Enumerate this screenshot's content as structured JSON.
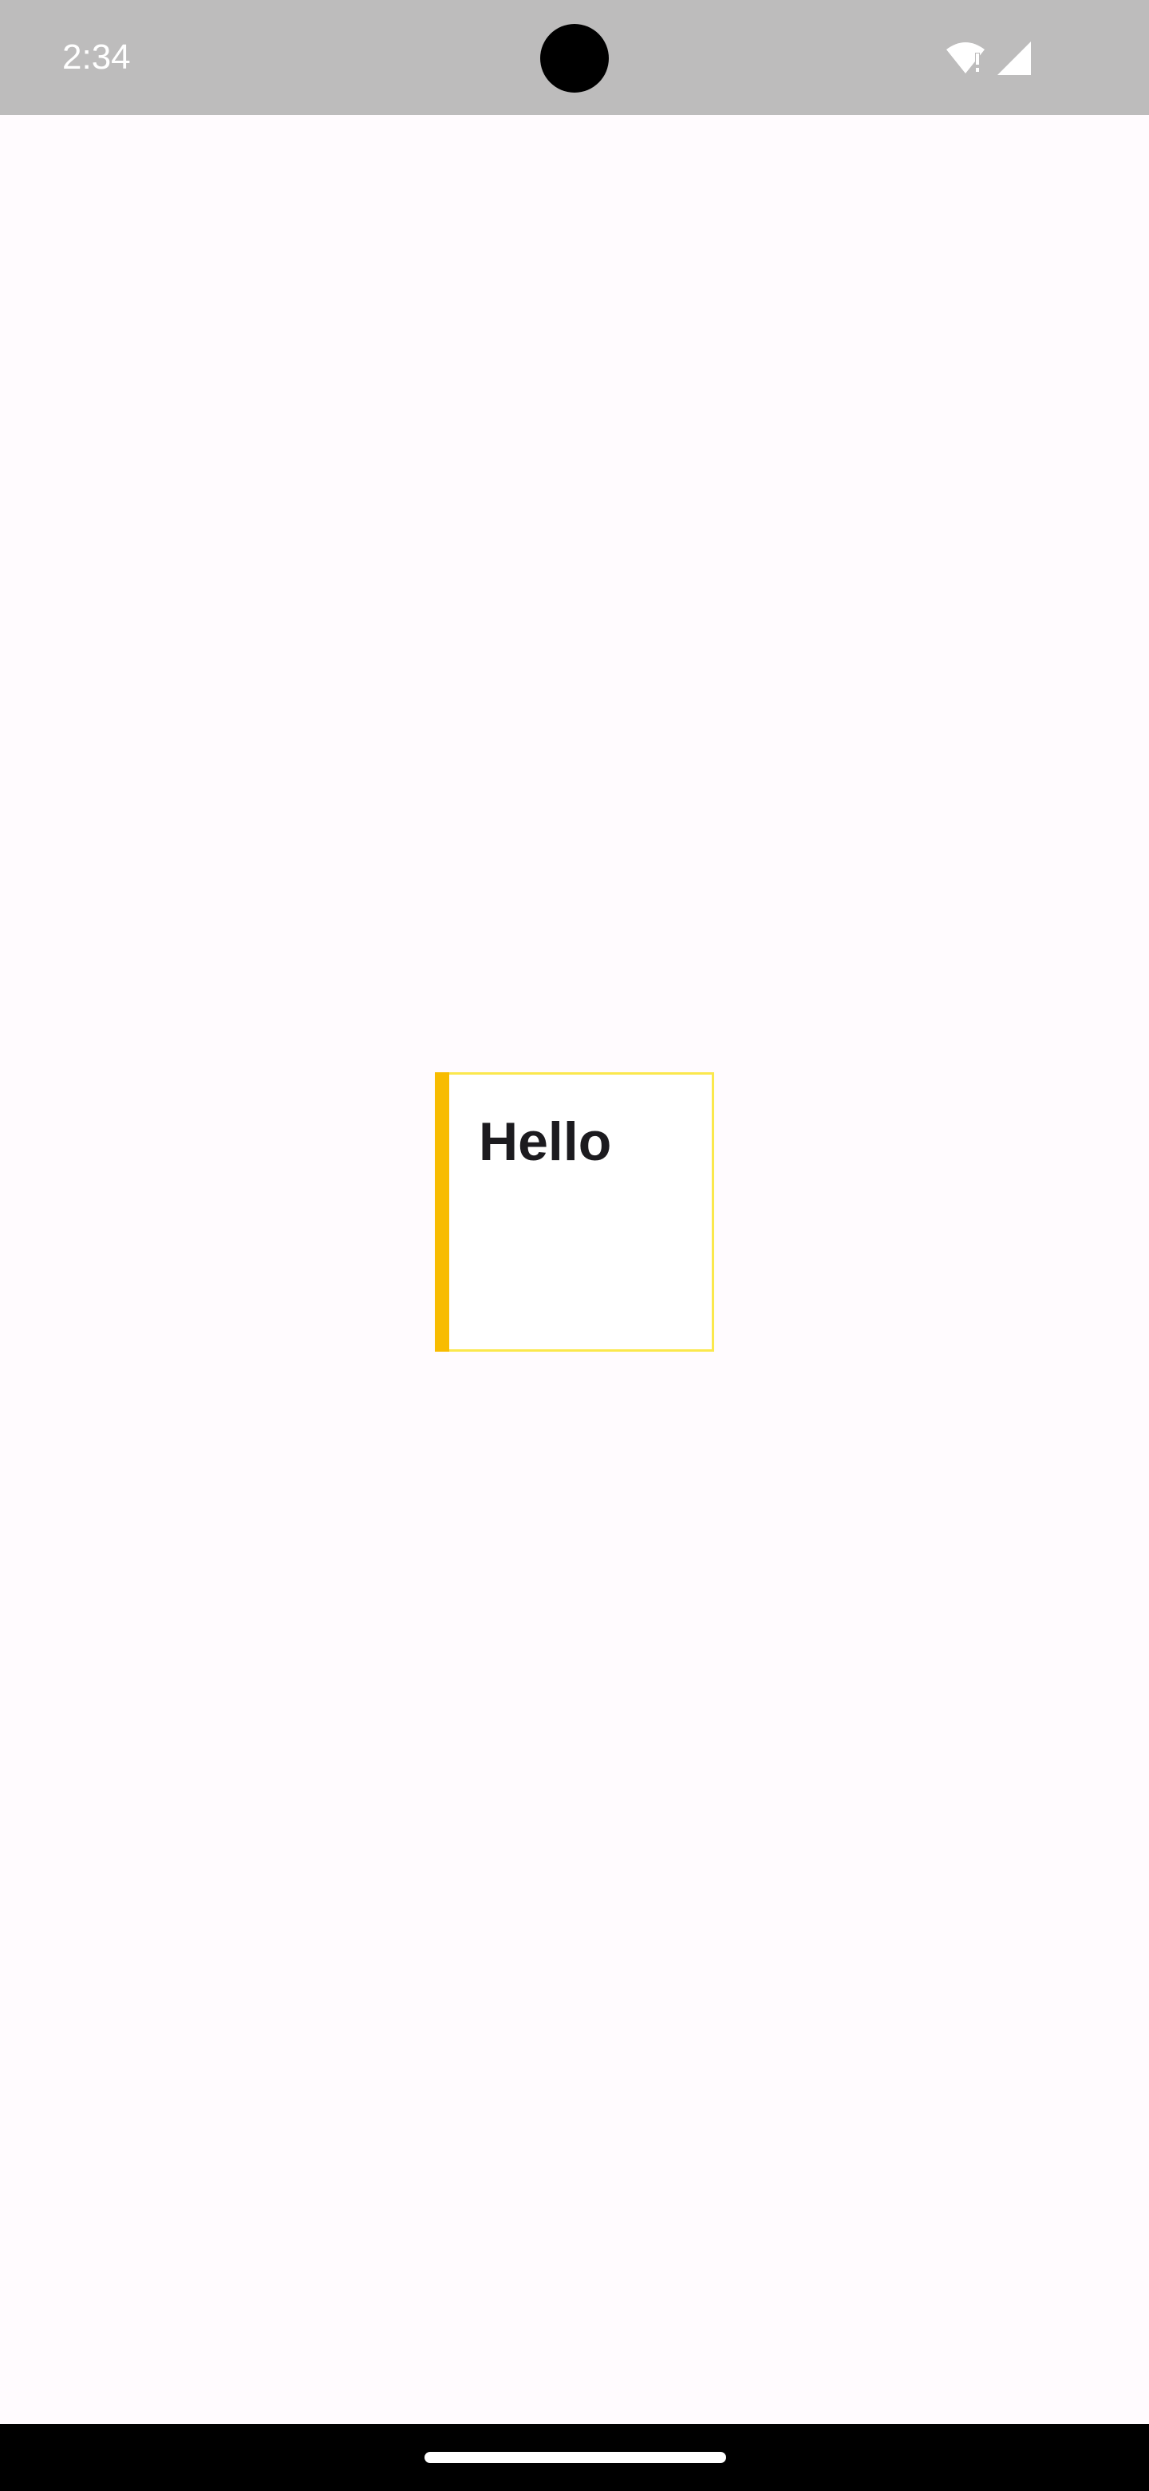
{
  "status_bar": {
    "time": "2:34",
    "icons": [
      "wifi-alert-icon",
      "cell-signal-icon"
    ]
  },
  "card": {
    "title": "Hello"
  },
  "colors": {
    "status_bar_bg": "#bdbcbc",
    "page_bg": "#fffbfe",
    "card_border": "#fbe84d",
    "card_accent": "#f8bc00",
    "title_text": "#1c1b1f",
    "nav_bar_bg": "#000000"
  }
}
